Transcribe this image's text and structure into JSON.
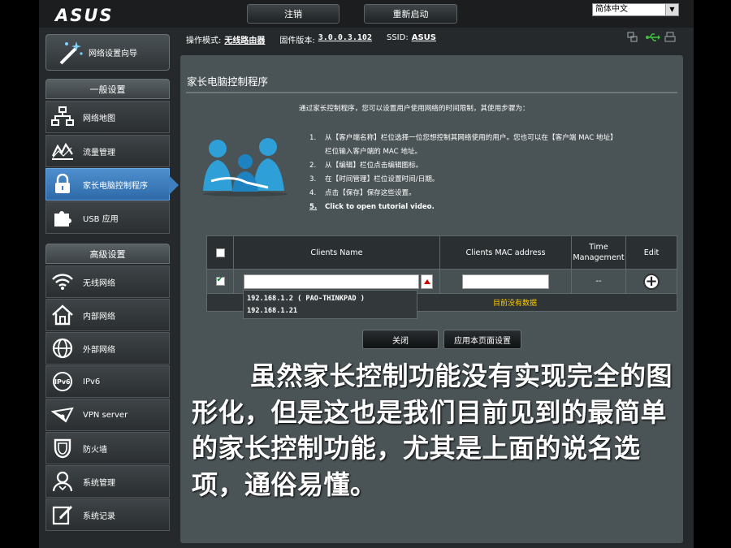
{
  "header": {
    "logo": "ASUS",
    "logout_label": "注销",
    "reboot_label": "重新启动",
    "language": "简体中文"
  },
  "status": {
    "mode_label": "操作模式:",
    "mode_value": "无线路由器",
    "firmware_label": "固件版本:",
    "firmware_value": "3.0.0.3.102",
    "ssid_label": "SSID:",
    "ssid_value": "ASUS"
  },
  "sidebar": {
    "wizard_label": "网络设置向导",
    "general_title": "一般设置",
    "general_items": [
      {
        "label": "网络地图",
        "icon": "network-map-icon"
      },
      {
        "label": "流量管理",
        "icon": "traffic-icon"
      },
      {
        "label": "家长电脑控制程序",
        "icon": "lock-icon",
        "active": true
      },
      {
        "label": "USB 应用",
        "icon": "puzzle-icon"
      }
    ],
    "advanced_title": "高级设置",
    "advanced_items": [
      {
        "label": "无线网络",
        "icon": "wifi-icon"
      },
      {
        "label": "内部网络",
        "icon": "home-icon"
      },
      {
        "label": "外部网络",
        "icon": "globe-icon"
      },
      {
        "label": "IPv6",
        "icon": "ipv6-icon"
      },
      {
        "label": "VPN server",
        "icon": "vpn-icon"
      },
      {
        "label": "防火墙",
        "icon": "shield-icon"
      },
      {
        "label": "系统管理",
        "icon": "admin-icon"
      },
      {
        "label": "系统记录",
        "icon": "log-icon"
      }
    ]
  },
  "main": {
    "title": "家长电脑控制程序",
    "intro": "通过家长控制程序，您可以设置用户使用网络的时间限制，其使用步骤为：",
    "steps": [
      {
        "num": "1.",
        "text": "从【客户端名称】栏位选择一位您想控制其网络使用的用户。您也可以在【客户端 MAC 地址】",
        "cont": "栏位输入客户端的 MAC 地址。"
      },
      {
        "num": "2.",
        "text": "从【编辑】栏位点击编辑图标。"
      },
      {
        "num": "3.",
        "text": "在【时间管理】栏位设置时间/日期。"
      },
      {
        "num": "4.",
        "text": "点击【保存】保存这些设置。"
      },
      {
        "num": "5.",
        "text": "Click to open tutorial video."
      }
    ],
    "table": {
      "headers": [
        "Clients Name",
        "Clients MAC address",
        "Time\nManagement",
        "Edit"
      ],
      "time_value": "--",
      "empty_text": "目前没有数据"
    },
    "suggestions": [
      "192.168.1.2 ( PAO-THINKPAD )",
      "192.168.1.21"
    ],
    "close_label": "关闭",
    "apply_label": "应用本页面设置"
  },
  "caption": "虽然家长控制功能没有实现完全的图形化，但是这也是我们目前见到的最简单的家长控制功能，尤其是上面的说名选项，通俗易懂。",
  "colors": {
    "active": "#3f7fbf",
    "panel": "#4a5356",
    "empty_text": "#ffcc00"
  }
}
